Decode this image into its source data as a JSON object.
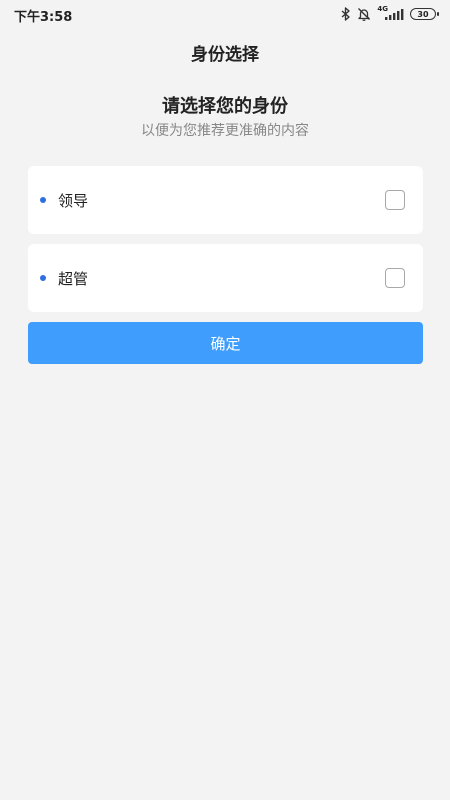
{
  "status_bar": {
    "time": "下午3:58",
    "network": "4G",
    "battery": "30",
    "icons": [
      "bluetooth-icon",
      "mute-bell-icon",
      "signal-icon",
      "battery-icon"
    ]
  },
  "header": {
    "title": "身份选择"
  },
  "intro": {
    "heading": "请选择您的身份",
    "subheading": "以便为您推荐更准确的内容"
  },
  "options": [
    {
      "label": "领导",
      "checked": false
    },
    {
      "label": "超管",
      "checked": false
    }
  ],
  "actions": {
    "confirm_label": "确定"
  },
  "colors": {
    "background": "#f3f3f3",
    "accent": "#3e9dfd",
    "bullet": "#2f6fe0",
    "card": "#ffffff"
  }
}
